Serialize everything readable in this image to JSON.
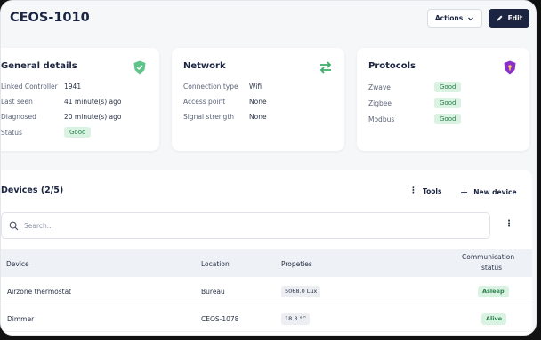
{
  "header": {
    "title": "CEOS-1010",
    "actions_label": "Actions",
    "edit_label": "Edit"
  },
  "general": {
    "title": "General details",
    "rows": [
      {
        "label": "Linked Controller",
        "value": "1941"
      },
      {
        "label": "Last seen",
        "value": "41 minute(s) ago"
      },
      {
        "label": "Diagnosed",
        "value": "20 minute(s) ago"
      },
      {
        "label": "Status",
        "value": "Good"
      }
    ]
  },
  "network": {
    "title": "Network",
    "rows": [
      {
        "label": "Connection type",
        "value": "Wifi"
      },
      {
        "label": "Access point",
        "value": "None"
      },
      {
        "label": "Signal strength",
        "value": "None"
      }
    ]
  },
  "protocols": {
    "title": "Protocols",
    "rows": [
      {
        "label": "Zwave",
        "value": "Good"
      },
      {
        "label": "Zigbee",
        "value": "Good"
      },
      {
        "label": "Modbus",
        "value": "Good"
      }
    ]
  },
  "devices": {
    "title": "Devices (2/5)",
    "tools_label": "Tools",
    "new_device_label": "New device",
    "search_placeholder": "Search...",
    "columns": [
      "Device",
      "Location",
      "Propeties",
      "Communication",
      "status"
    ],
    "rows": [
      {
        "device": "Airzone thermostat",
        "location": "Bureau",
        "property": "5068.0 Lux",
        "status": "Asleep"
      },
      {
        "device": "Dimmer",
        "location": "CEOS-1078",
        "property": "18.3 °C",
        "status": "Alive"
      }
    ]
  },
  "colors": {
    "primary": "#1b2541",
    "good_bg": "#d9f2e2",
    "good_text": "#2c7d4a",
    "general_icon": "#5ec48a",
    "network_icon": "#3fae6a",
    "protocol_icon": "#8b2fc9"
  },
  "icons": [
    "chevron-down-icon",
    "pencil-icon",
    "shield-check-icon",
    "arrows-swap-icon",
    "shield-lock-icon",
    "kebab-icon",
    "plus-icon",
    "search-icon"
  ]
}
